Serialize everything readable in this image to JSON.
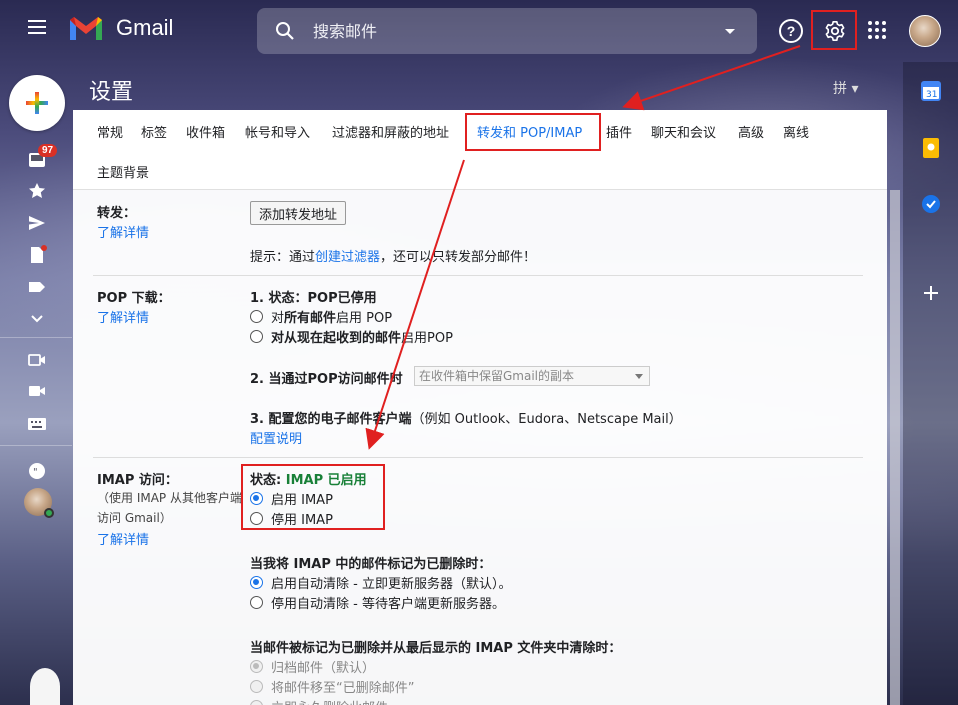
{
  "app": {
    "name": "Gmail"
  },
  "search": {
    "placeholder": "搜索邮件"
  },
  "header": {
    "help_label": "?"
  },
  "rail": {
    "inbox_badge": "97"
  },
  "settings": {
    "title": "设置",
    "ime": "拼 ▾",
    "tabs": [
      "常规",
      "标签",
      "收件箱",
      "帐号和导入",
      "过滤器和屏蔽的地址",
      "转发和 POP/IMAP",
      "插件",
      "聊天和会议",
      "高级",
      "离线",
      "主题背景"
    ],
    "active_tab": "转发和 POP/IMAP"
  },
  "forwarding": {
    "label": "转发：",
    "learn_more": "了解详情",
    "add_button": "添加转发地址",
    "tip_prefix": "提示：通过",
    "tip_link": "创建过滤器",
    "tip_suffix": "，还可以只转发部分邮件！"
  },
  "pop": {
    "label": "POP 下载：",
    "learn_more": "了解详情",
    "status_prefix": "1. 状态：",
    "status_value": "POP已停用",
    "opt1_prefix": "对",
    "opt1_bold": "所有邮件",
    "opt1_suffix": "启用 POP",
    "opt2_bold": "对从现在起收到的邮件",
    "opt2_suffix": "启用POP",
    "step2": "2. 当通过POP访问邮件时",
    "step2_select": "在收件箱中保留Gmail的副本",
    "step3_bold": "3. 配置您的电子邮件客户端",
    "step3_rest": "（例如 Outlook、Eudora、Netscape Mail）",
    "config_link": "配置说明"
  },
  "imap": {
    "label": "IMAP 访问：",
    "sub": "（使用 IMAP 从其他客户端访问 Gmail）",
    "learn_more": "了解详情",
    "status_prefix": "状态: ",
    "status_value": "IMAP 已启用",
    "enable": "启用 IMAP",
    "disable": "停用 IMAP",
    "deleted_heading": "当我将 IMAP 中的邮件标记为已删除时：",
    "auto_on": "启用自动清除 - 立即更新服务器（默认）。",
    "auto_off": "停用自动清除 - 等待客户端更新服务器。",
    "expunge_heading": "当邮件被标记为已删除并从最后显示的 IMAP 文件夹中清除时：",
    "archive": "归档邮件（默认）",
    "trash": "将邮件移至“已删除邮件”",
    "delete_forever": "立即永久删除此邮件"
  },
  "icons": [
    "menu-icon",
    "gmail-logo-icon",
    "search-icon",
    "help-icon",
    "gear-icon",
    "apps-icon",
    "inbox-icon",
    "star-icon",
    "send-icon",
    "drafts-icon",
    "label-icon",
    "video-icon",
    "keyboard-icon",
    "chat-icon",
    "calendar-icon",
    "keep-icon",
    "tasks-icon",
    "add-icon"
  ]
}
